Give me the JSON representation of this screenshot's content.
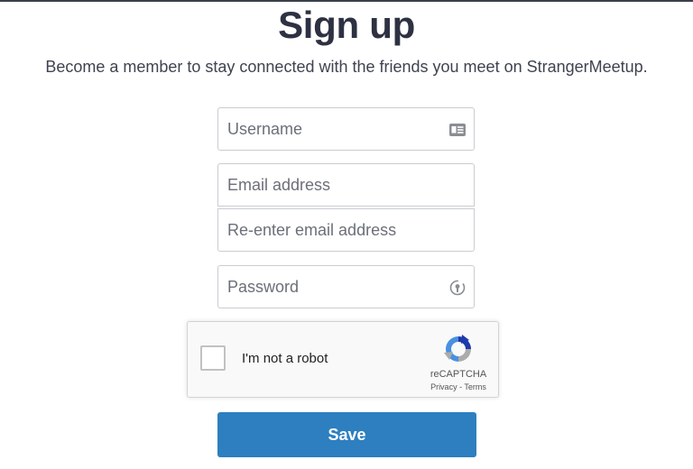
{
  "page": {
    "title": "Sign up",
    "subtitle": "Become a member to stay connected with the friends you meet on StrangerMeetup."
  },
  "form": {
    "username_placeholder": "Username",
    "username_icon": "id-card-icon",
    "email_placeholder": "Email address",
    "email_confirm_placeholder": "Re-enter email address",
    "password_placeholder": "Password",
    "password_icon": "password-manager-icon"
  },
  "captcha": {
    "label": "I'm not a robot",
    "brand": "reCAPTCHA",
    "privacy": "Privacy",
    "separator": " - ",
    "terms": "Terms",
    "checked": false
  },
  "actions": {
    "save_label": "Save"
  },
  "colors": {
    "title": "#2d3142",
    "primary_button": "#2d7fbf",
    "field_border": "#c9ccd1",
    "topbar": "#3a3f4b"
  }
}
